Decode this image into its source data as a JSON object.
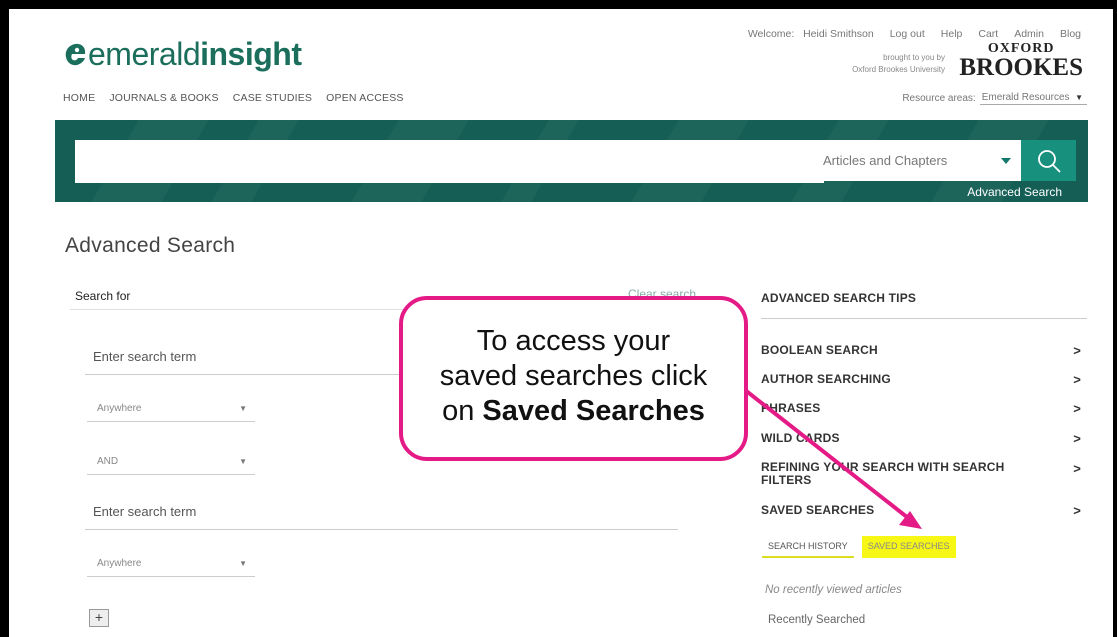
{
  "header": {
    "logo_light": "emerald",
    "logo_bold": "insight",
    "welcome_label": "Welcome:",
    "user_name": "Heidi Smithson",
    "logout": "Log out",
    "help": "Help",
    "cart": "Cart",
    "admin": "Admin",
    "blog": "Blog",
    "brought_line1": "brought to you by",
    "brought_line2": "Oxford Brookes University",
    "inst_top": "OXFORD",
    "inst_bottom": "BROOKES",
    "resource_label": "Resource areas:",
    "resource_value": "Emerald Resources"
  },
  "nav": [
    "HOME",
    "JOURNALS & BOOKS",
    "CASE STUDIES",
    "OPEN ACCESS"
  ],
  "search": {
    "query": "",
    "scope": "Articles and Chapters",
    "advanced_link": "Advanced Search"
  },
  "page": {
    "title": "Advanced Search"
  },
  "form": {
    "search_for": "Search for",
    "clear_search": "Clear search",
    "term1_placeholder": "Enter search term",
    "field1": "Anywhere",
    "operator": "AND",
    "term2_placeholder": "Enter search term",
    "field2": "Anywhere",
    "add": "+"
  },
  "tips": {
    "heading": "ADVANCED SEARCH TIPS",
    "items": [
      {
        "label": "BOOLEAN SEARCH"
      },
      {
        "label": "AUTHOR SEARCHING"
      },
      {
        "label": "PHRASES"
      },
      {
        "label": "WILD CARDS"
      },
      {
        "label": "REFINING YOUR SEARCH WITH SEARCH FILTERS"
      },
      {
        "label": "SAVED SEARCHES"
      }
    ],
    "chevron": ">"
  },
  "history": {
    "tab_history": "SEARCH HISTORY",
    "tab_saved": "SAVED SEARCHES",
    "no_viewed": "No recently viewed articles",
    "recently_searched": "Recently Searched"
  },
  "callout": {
    "line1": "To access your",
    "line2": "saved searches click",
    "line3_prefix": "on",
    "line3_bold": "Saved Searches"
  },
  "colors": {
    "brand": "#1a6e5b",
    "banner": "#145e55",
    "button": "#17907d",
    "callout": "#e41b86",
    "highlight": "#f7f716"
  }
}
